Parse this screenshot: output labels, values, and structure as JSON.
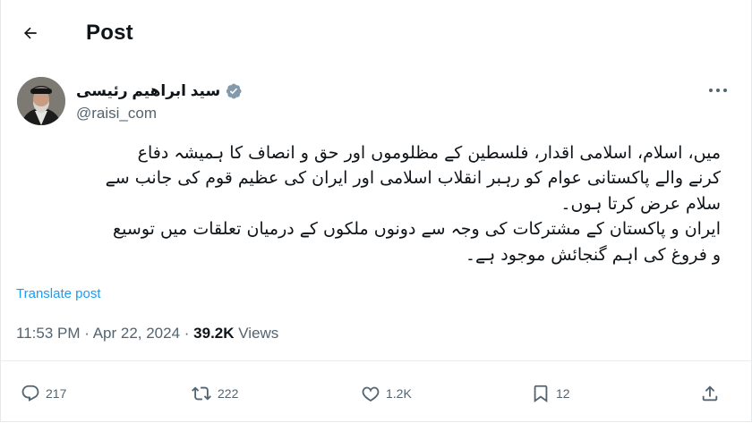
{
  "header": {
    "title": "Post"
  },
  "author": {
    "display_name": "سید ابراهیم رئیسی",
    "handle": "@raisi_com"
  },
  "post": {
    "lines": [
      "میں، اسلام، اسلامی اقدار، فلسطین کے مظلوموں اور حق و انصاف کا ہمیشہ دفاع",
      "کرنے والے پاکستانی عوام کو رہبر انقلاب اسلامی اور ایران کی عظیم قوم کی جانب سے",
      "سلام عرض کرتا ہوں۔",
      "ایران و پاکستان کے مشترکات کی وجہ سے دونوں ملکوں کے درمیان تعلقات میں توسیع",
      "و فروغ کی اہم گنجائش موجود ہے۔"
    ],
    "translate_label": "Translate post",
    "time": "11:53 PM",
    "separator1": " · ",
    "date": "Apr 22, 2024",
    "separator2": " · ",
    "views_count": "39.2K",
    "views_label": " Views"
  },
  "actions": {
    "replies": "217",
    "reposts": "222",
    "likes": "1.2K",
    "bookmarks": "12"
  },
  "colors": {
    "accent": "#1d9bf0",
    "secondary_text": "#536471",
    "verified_badge": "#829aab"
  }
}
